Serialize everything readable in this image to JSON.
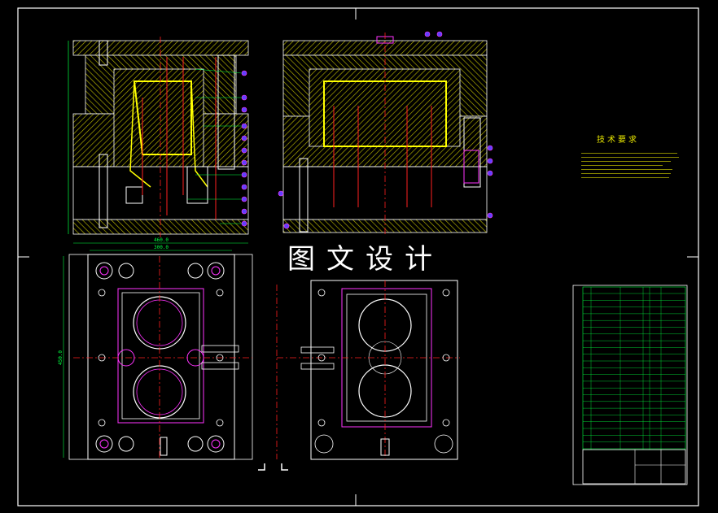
{
  "watermark": "图文设计",
  "technical_requirements": {
    "title": "技术要求"
  },
  "dimensions": {
    "width_top": "460.0",
    "width_inner": "300.0",
    "height_left": "450.0"
  },
  "colors": {
    "background": "#000000",
    "frame": "#ffffff",
    "hatch": "#e8e600",
    "centerline": "#ff2020",
    "cyan": "#00e5ff",
    "magenta": "#ff33ff",
    "green": "#00ff40",
    "yellow": "#ffff00"
  }
}
